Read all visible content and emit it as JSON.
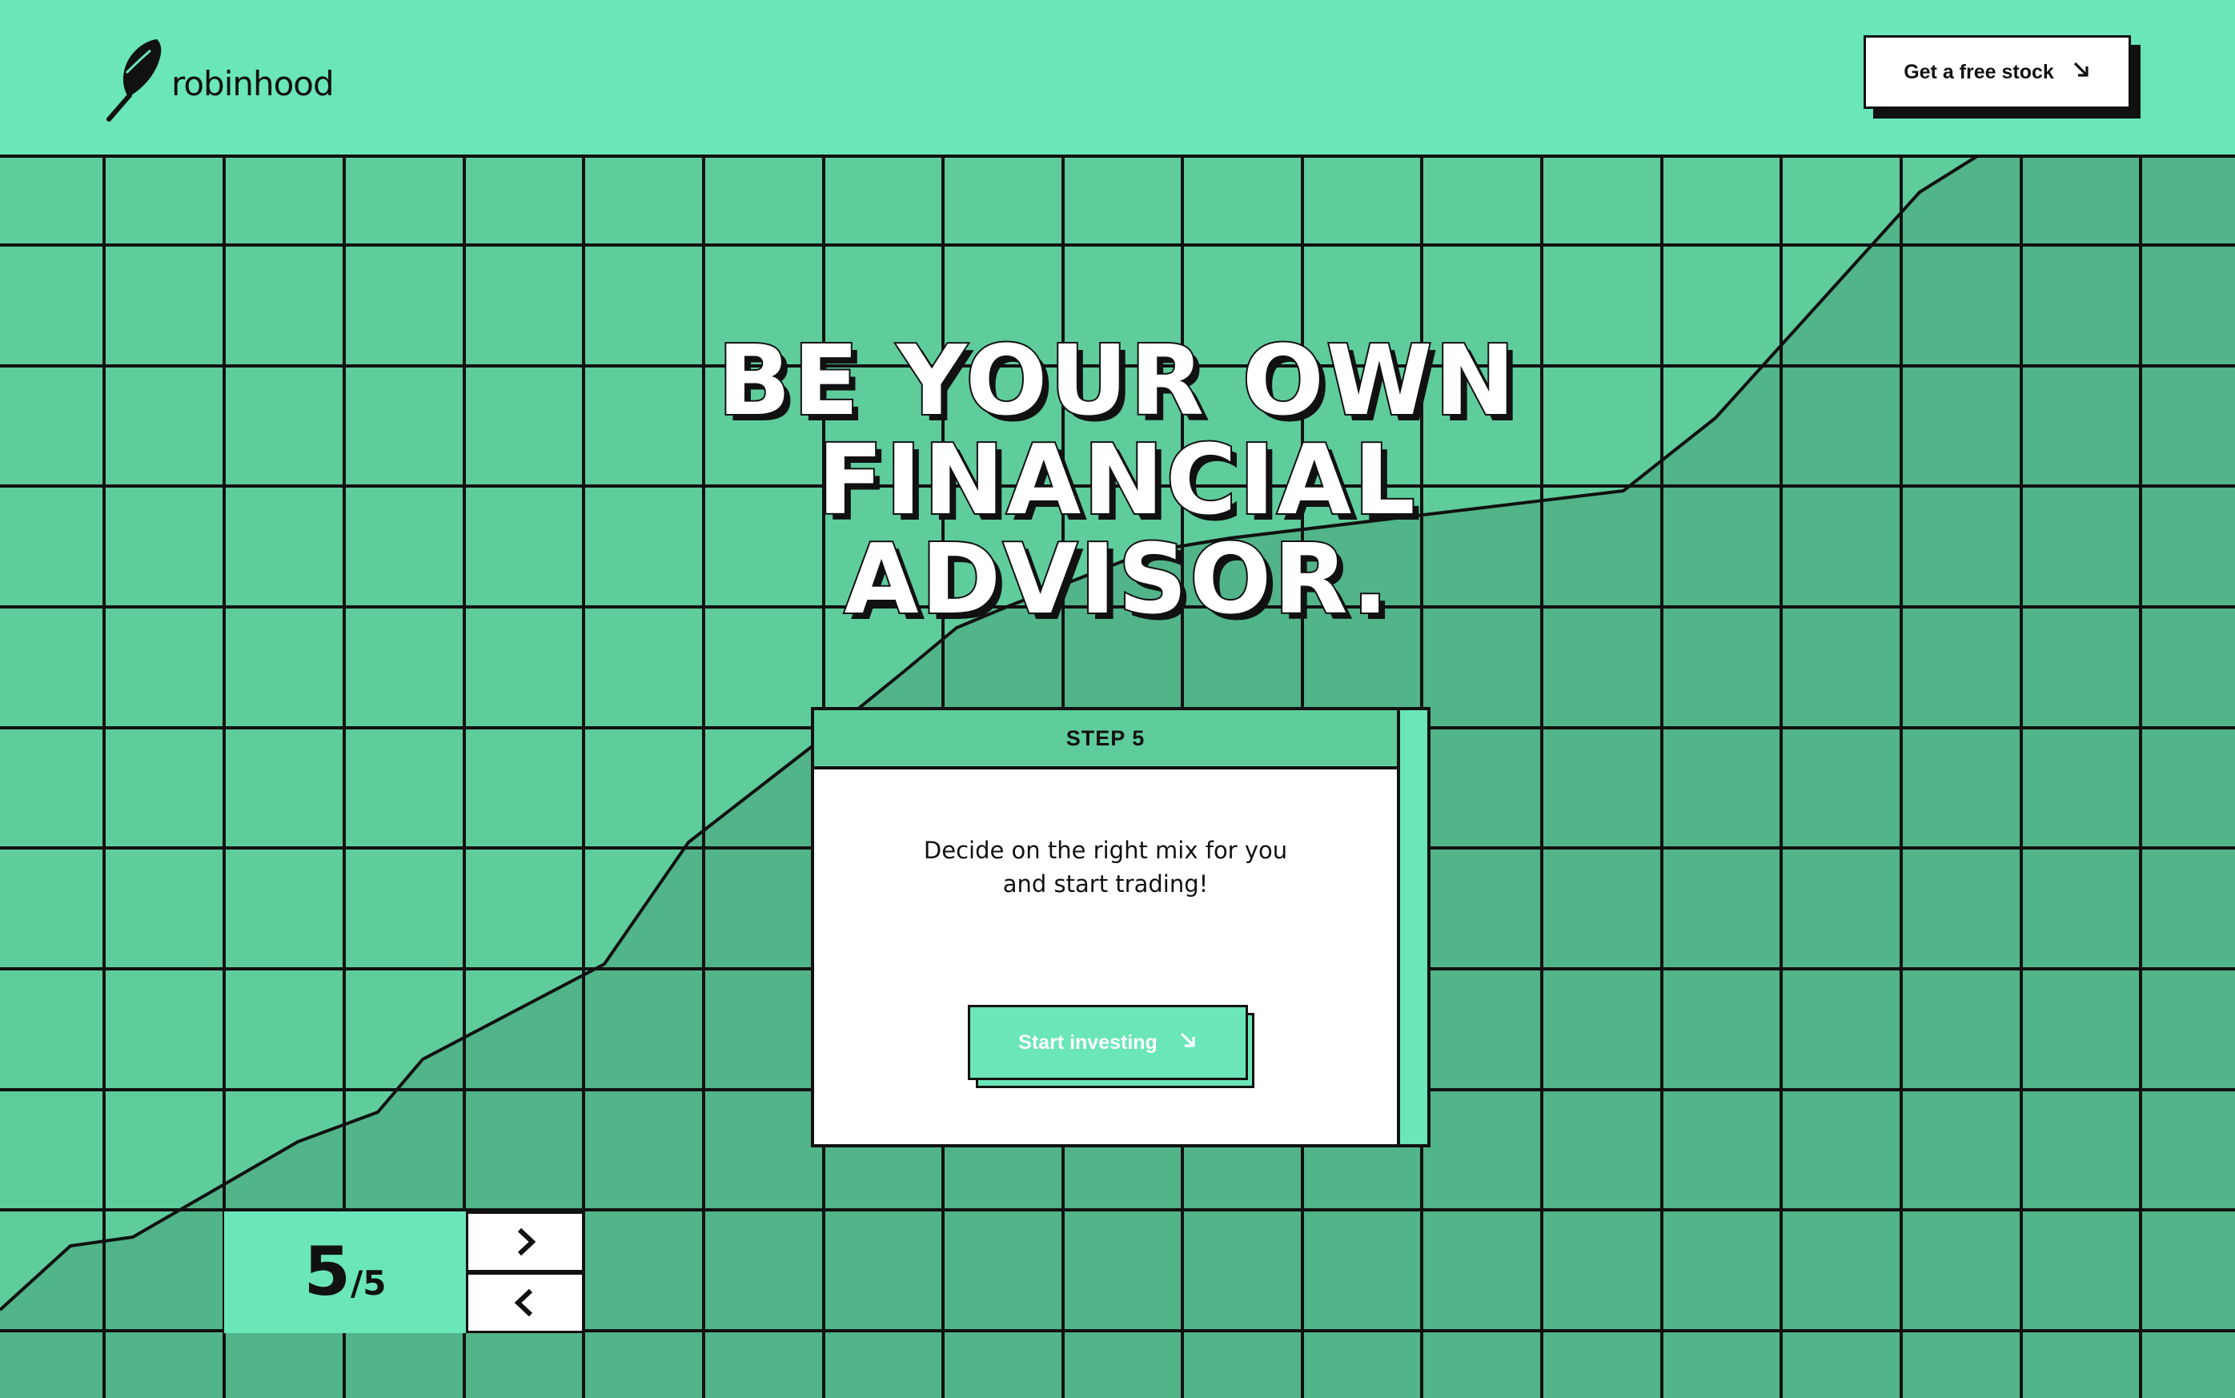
{
  "brand": {
    "name": "robinhood"
  },
  "header": {
    "cta_label": "Get a free stock"
  },
  "hero": {
    "lines": [
      "BE YOUR OWN",
      "FINANCIAL",
      "ADVISOR."
    ]
  },
  "step": {
    "label": "STEP 5",
    "description_lines": [
      "Decide on the right mix for you",
      "and start trading!"
    ],
    "button_label": "Start investing"
  },
  "pager": {
    "current": "5",
    "total": "/5"
  },
  "icons": {
    "logo": "feather-logo-icon",
    "cta": "arrow-down-right-icon",
    "next": "chevron-right-icon",
    "prev": "chevron-left-icon"
  },
  "colors": {
    "header_bg": "#6ae6b8",
    "grid_fill_light": "#5fcc9c",
    "grid_fill_dark": "#52b489",
    "ink": "#111111",
    "card_bg": "#ffffff"
  }
}
